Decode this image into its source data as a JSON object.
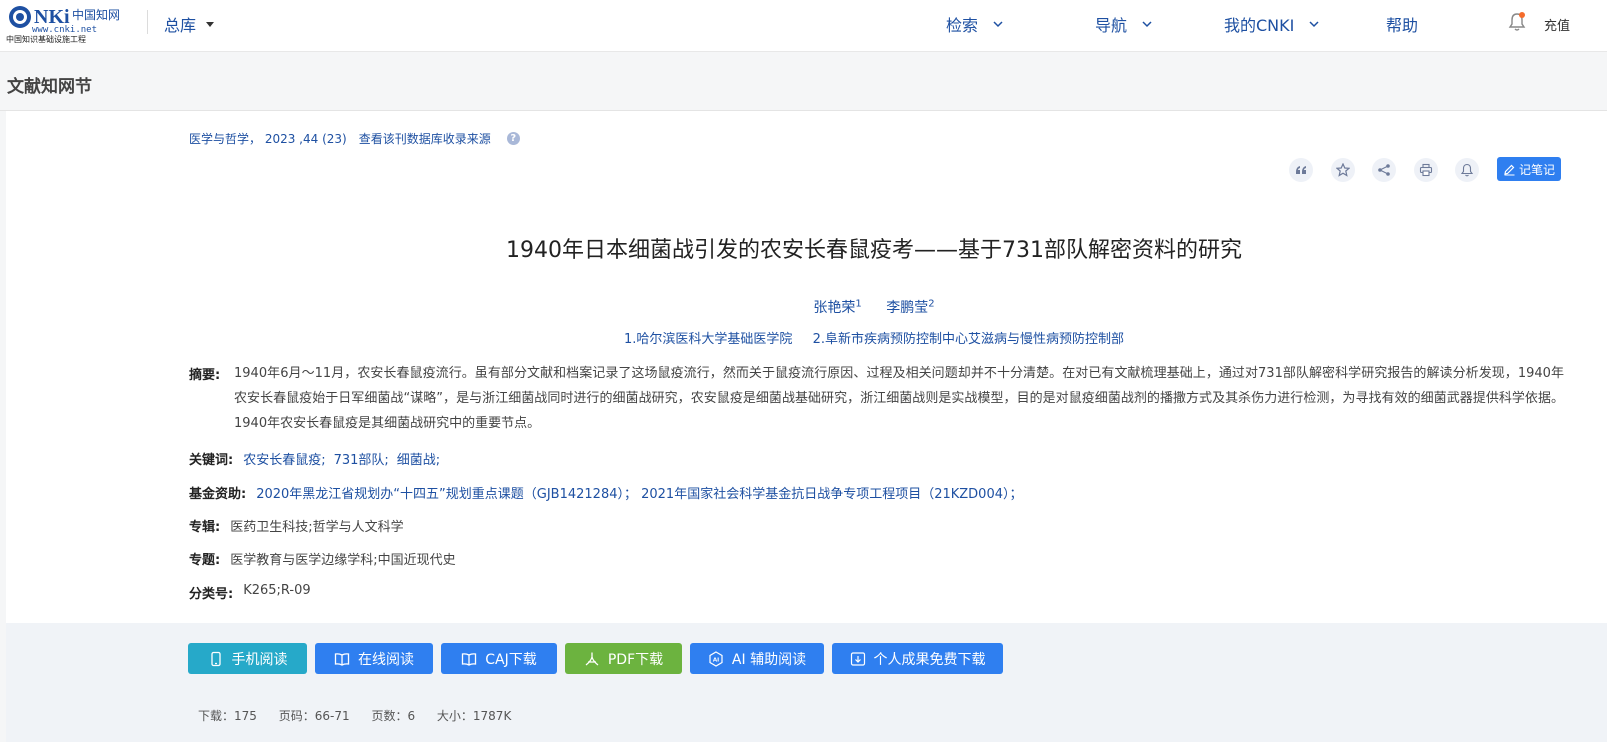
{
  "header": {
    "logo_text": "CNKi 中国知网 www.cnki.net",
    "logo_subtitle": "中国知识基础设施工程",
    "library_menu": "总库",
    "nav": [
      {
        "label": "检索"
      },
      {
        "label": "导航"
      },
      {
        "label": "我的CNKI"
      },
      {
        "label": "帮助"
      }
    ],
    "recharge": "充值"
  },
  "section_title": "文献知网节",
  "article": {
    "source": "医学与哲学， 2023 ,44 (23)",
    "source_link": "查看该刊数据库收录来源",
    "help_mark": "?",
    "note_button": "记笔记",
    "title": "1940年日本细菌战引发的农安长春鼠疫考——基于731部队解密资料的研究",
    "authors": [
      {
        "name": "张艳荣",
        "sup": "1"
      },
      {
        "name": "李鹏莹",
        "sup": "2"
      }
    ],
    "orgs": [
      "1.哈尔滨医科大学基础医学院",
      "2.阜新市疾病预防控制中心艾滋病与慢性病预防控制部"
    ],
    "abstract_label": "摘要:",
    "abstract": "1940年6月～11月，农安长春鼠疫流行。虽有部分文献和档案记录了这场鼠疫流行，然而关于鼠疫流行原因、过程及相关问题却并不十分清楚。在对已有文献梳理基础上，通过对731部队解密科学研究报告的解读分析发现，1940年农安长春鼠疫始于日军细菌战“谋略”，是与浙江细菌战同时进行的细菌战研究，农安鼠疫是细菌战基础研究，浙江细菌战则是实战模型，目的是对鼠疫细菌战剂的播撒方式及其杀伤力进行检测，为寻找有效的细菌武器提供科学依据。1940年农安长春鼠疫是其细菌战研究中的重要节点。",
    "keywords_label": "关键词:",
    "keywords": [
      "农安长春鼠疫;",
      "731部队;",
      "细菌战;"
    ],
    "fund_label": "基金资助:",
    "funds": "2020年黑龙江省规划办“十四五”规划重点课题（GJB1421284）；  2021年国家社会科学基金抗日战争专项工程项目（21KZD004）；",
    "series_label": "专辑:",
    "series": "医药卫生科技;哲学与人文科学",
    "topic_label": "专题:",
    "topic": "医学教育与医学边缘学科;中国近现代史",
    "class_label": "分类号:",
    "class_no": "K265;R-09"
  },
  "actions": {
    "mobile_read": "手机阅读",
    "online_read": "在线阅读",
    "caj_download": "CAJ下载",
    "pdf_download": "PDF下载",
    "ai_read": "AI 辅助阅读",
    "personal_download": "个人成果免费下载"
  },
  "stats": {
    "downloads": "下载：175",
    "pages_range": "页码：66-71",
    "pages_count": "页数：6",
    "size": "大小：1787K"
  },
  "colors": {
    "link_blue": "#1e50a2",
    "btn_teal": "#26a9c9",
    "btn_blue": "#2f7ff0",
    "btn_green": "#6cb33f"
  }
}
